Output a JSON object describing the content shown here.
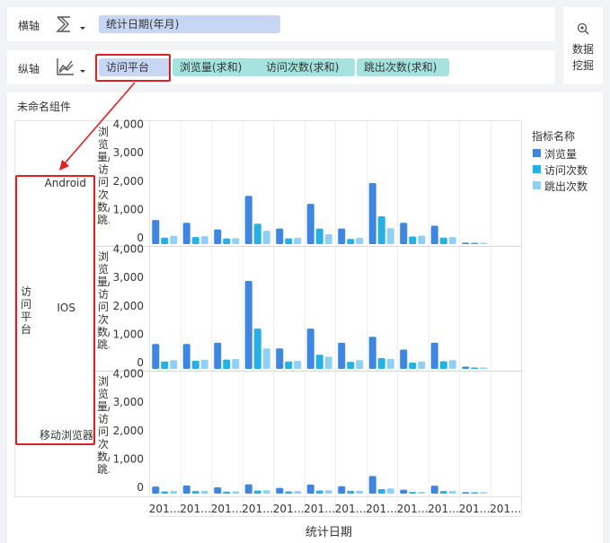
{
  "toolbar": {
    "x_axis_label": "横轴",
    "y_axis_label": "纵轴",
    "x_fields": [
      "统计日期(年月)"
    ],
    "y_fields": [
      "访问平台",
      "浏览量(求和)",
      "访问次数(求和)",
      "跳出次数(求和)"
    ],
    "mining_label_1": "数据",
    "mining_label_2": "挖掘"
  },
  "component": {
    "title": "未命名组件"
  },
  "legend": {
    "title": "指标名称",
    "items": [
      "浏览量",
      "访问次数",
      "跳出次数"
    ]
  },
  "colors": {
    "series1": "#3f86e0",
    "series2": "#27b0e6",
    "series3": "#8fd0f5",
    "highlight": "#e02020"
  },
  "chart_data": {
    "type": "bar",
    "row_dimension": "访问平台",
    "row_dimension_vertical": "访问平台",
    "rows": [
      "Android",
      "IOS",
      "移动浏览器"
    ],
    "y_axis_title": "浏览量/访问次数/跳…",
    "y_ticks": [
      "0",
      "1,000",
      "2,000",
      "3,000",
      "4,000"
    ],
    "ylim": [
      0,
      4000
    ],
    "xlabel": "统计日期",
    "categories": [
      "201…",
      "201…",
      "201…",
      "201…",
      "201…",
      "201…",
      "201…",
      "201…",
      "201…",
      "201…",
      "201…",
      "201…"
    ],
    "series": [
      {
        "name": "浏览量",
        "values": [
          [
            850,
            750,
            520,
            1700,
            550,
            1420,
            550,
            2150,
            750,
            650,
            50
          ],
          [
            880,
            880,
            920,
            3100,
            720,
            1420,
            920,
            1130,
            680,
            920,
            80
          ],
          [
            250,
            290,
            220,
            330,
            200,
            320,
            260,
            620,
            140,
            280,
            50
          ]
        ]
      },
      {
        "name": "访问次数",
        "values": [
          [
            230,
            250,
            200,
            720,
            200,
            550,
            180,
            980,
            270,
            230,
            40
          ],
          [
            260,
            290,
            330,
            1420,
            260,
            500,
            250,
            380,
            220,
            270,
            40
          ],
          [
            80,
            90,
            70,
            110,
            80,
            110,
            100,
            160,
            60,
            90,
            30
          ]
        ]
      },
      {
        "name": "跳出次数",
        "values": [
          [
            290,
            280,
            210,
            470,
            220,
            350,
            220,
            560,
            300,
            250,
            40
          ],
          [
            310,
            320,
            350,
            720,
            280,
            430,
            310,
            350,
            260,
            310,
            40
          ],
          [
            90,
            100,
            80,
            120,
            90,
            120,
            100,
            180,
            60,
            90,
            30
          ]
        ]
      }
    ],
    "groups_count": 11
  }
}
